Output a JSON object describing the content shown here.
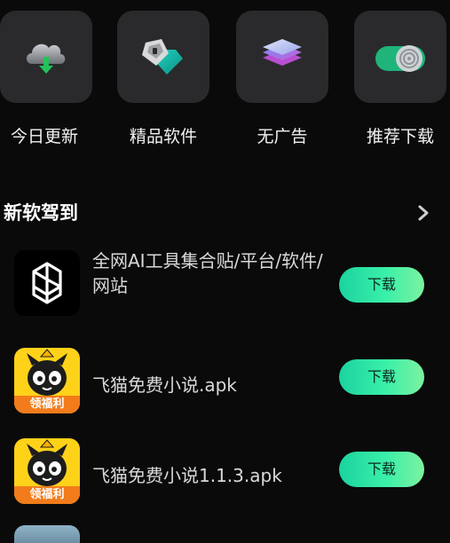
{
  "categories": [
    {
      "label": "今日更新",
      "icon": "cloud-download-icon"
    },
    {
      "label": "精品软件",
      "icon": "gem-icon"
    },
    {
      "label": "无广告",
      "icon": "layers-icon"
    },
    {
      "label": "推荐下载",
      "icon": "toggle-target-icon"
    }
  ],
  "section": {
    "title": "新软驾到",
    "more_icon": "chevron-right-icon"
  },
  "apps": [
    {
      "name": "全网AI工具集合贴/平台/软件/网站",
      "button": "下载",
      "icon": "openai-logo-icon"
    },
    {
      "name": "飞猫免费小说.apk",
      "button": "下载",
      "icon": "feimao-cat-icon",
      "badge": "领福利"
    },
    {
      "name": "飞猫免费小说1.1.3.apk",
      "button": "下载",
      "icon": "feimao-cat-icon",
      "badge": "领福利"
    }
  ],
  "colors": {
    "background": "#0a0a0a",
    "tile": "#2a2a2c",
    "accent_green": "#2ee6a6",
    "badge_orange": "#f27c1b"
  }
}
